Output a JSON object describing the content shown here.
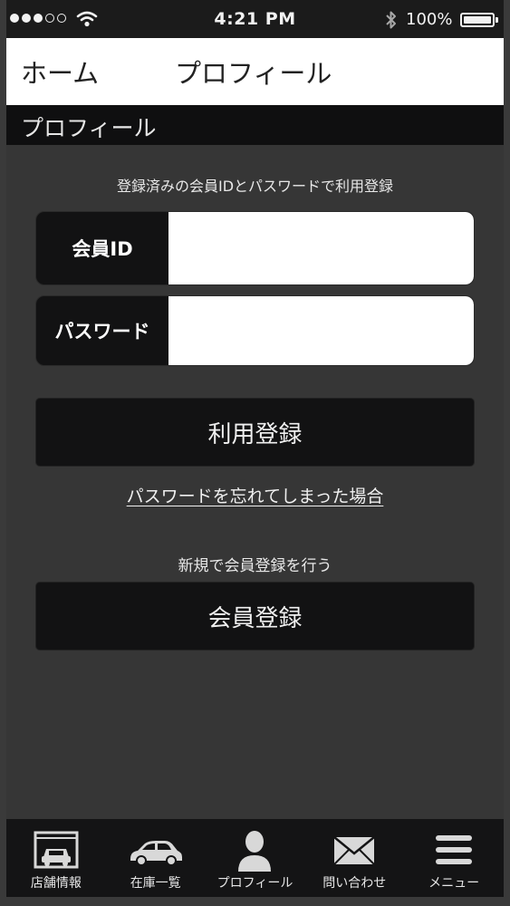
{
  "status_bar": {
    "time": "4:21 PM",
    "battery_percent": "100%",
    "signal_bars_filled": 3,
    "signal_bars_total": 5
  },
  "nav": {
    "home_label": "ホーム",
    "title": "プロフィール"
  },
  "section": {
    "title": "プロフィール"
  },
  "form": {
    "instruction": "登録済みの会員IDとパスワードで利用登録",
    "member_id_label": "会員ID",
    "member_id_value": "",
    "password_label": "パスワード",
    "password_value": "",
    "submit_label": "利用登録",
    "forgot_link": "パスワードを忘れてしまった場合",
    "new_member_text": "新規で会員登録を行う",
    "register_label": "会員登録"
  },
  "tabs": [
    {
      "label": "店舗情報",
      "icon": "garage-icon"
    },
    {
      "label": "在庫一覧",
      "icon": "car-icon"
    },
    {
      "label": "プロフィール",
      "icon": "person-icon"
    },
    {
      "label": "問い合わせ",
      "icon": "mail-icon"
    },
    {
      "label": "メニュー",
      "icon": "menu-icon"
    }
  ],
  "colors": {
    "background": "#363636",
    "panel": "#121213",
    "header": "#0f0f10",
    "text": "#f0f0f0"
  }
}
